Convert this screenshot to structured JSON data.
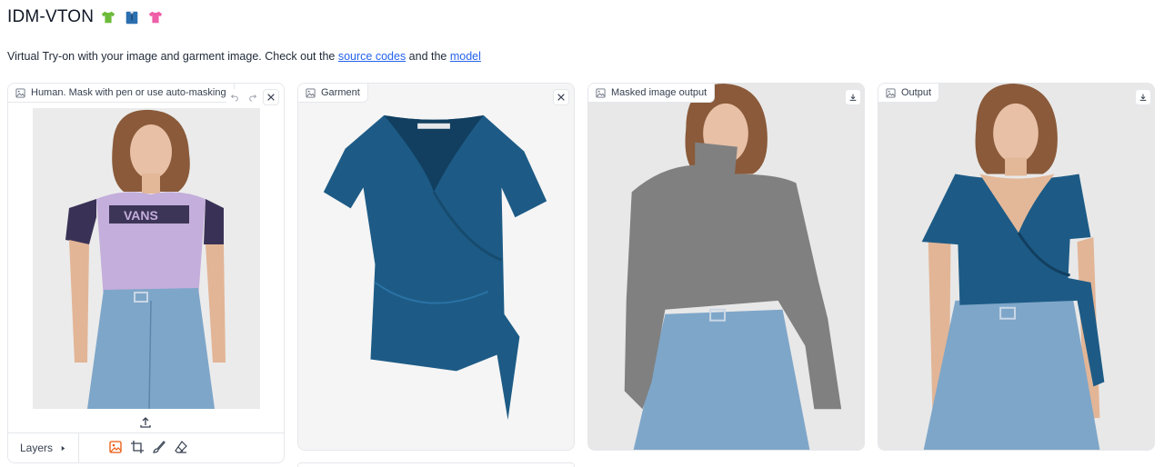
{
  "header": {
    "title": "IDM-VTON",
    "emoji_1": "green-tshirt-icon",
    "emoji_2": "suit-icon",
    "emoji_3": "pink-tshirt-icon"
  },
  "description": {
    "text_before": "Virtual Try-on with your image and garment image. Check out the ",
    "link_source": "source codes",
    "text_middle": " and the ",
    "link_model": "model"
  },
  "panels": {
    "human": {
      "label": "Human. Mask with pen or use auto-masking",
      "layers_label": "Layers"
    },
    "garment": {
      "label": "Garment"
    },
    "masked": {
      "label": "Masked image output"
    },
    "output": {
      "label": "Output"
    }
  },
  "colors": {
    "link": "#2563eb",
    "tool_active": "#ea580c",
    "garment_blue": "#1d5b86",
    "shirt_purple": "#c4aedb",
    "jeans": "#7ea6c9",
    "mask_gray": "#808080"
  }
}
